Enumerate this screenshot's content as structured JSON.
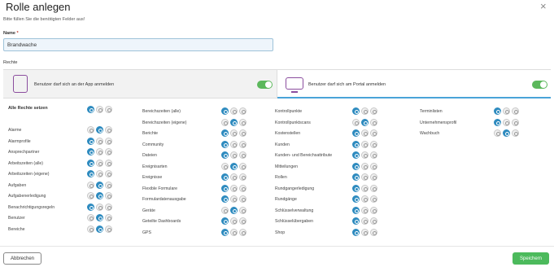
{
  "dialog": {
    "title": "Rolle anlegen",
    "close_glyph": "×",
    "subtitle": "Bitte füllen Sie die benötigten Felder aus!"
  },
  "name_field": {
    "label": "Name",
    "required_mark": "*",
    "value": "Brandwache"
  },
  "rights": {
    "label": "Rechte",
    "app_permission": {
      "text": "Benutzer darf sich an der App anmelden",
      "enabled": true,
      "icon": "phone-icon"
    },
    "portal_permission": {
      "text": "Benutzer darf sich am Portal anmelden",
      "enabled": true,
      "icon": "monitor-icon"
    },
    "all_rights_label": "Alle Rechte setzen",
    "all_rights_state": 0,
    "columns": [
      {
        "items": [
          {
            "label": "Alarme",
            "state": 1
          },
          {
            "label": "Alarmprofile",
            "state": 0
          },
          {
            "label": "Ansprechpartner",
            "state": 0
          },
          {
            "label": "Arbeitszeiten (alle)",
            "state": 0
          },
          {
            "label": "Arbeitszeiten (eigene)",
            "state": 0
          },
          {
            "label": "Aufgaben",
            "state": 1
          },
          {
            "label": "Aufgabenerledigung",
            "state": 1
          },
          {
            "label": "Benachrichtigungsregeln",
            "state": 0
          },
          {
            "label": "Benutzer",
            "state": 1
          },
          {
            "label": "Bereiche",
            "state": 1
          }
        ]
      },
      {
        "items": [
          {
            "label": "Bereichszeiten (alle)",
            "state": 0
          },
          {
            "label": "Bereichszeiten (eigene)",
            "state": 1
          },
          {
            "label": "Berichte",
            "state": 0
          },
          {
            "label": "Community",
            "state": 0
          },
          {
            "label": "Dateien",
            "state": 0
          },
          {
            "label": "Ereignisarten",
            "state": 1
          },
          {
            "label": "Ereignisse",
            "state": 0
          },
          {
            "label": "Flexible Formulare",
            "state": 0
          },
          {
            "label": "Formulardatenausgabe",
            "state": 0
          },
          {
            "label": "Geräte",
            "state": 1
          },
          {
            "label": "Geteilte Dashboards",
            "state": 0
          },
          {
            "label": "GPS",
            "state": 0
          }
        ]
      },
      {
        "items": [
          {
            "label": "Kontrollpunkte",
            "state": 0
          },
          {
            "label": "Kontrollpunktscans",
            "state": 1
          },
          {
            "label": "Kostenstellen",
            "state": 0
          },
          {
            "label": "Kunden",
            "state": 0
          },
          {
            "label": "Kunden- und Bereichsattribute",
            "state": 0
          },
          {
            "label": "Mitteilungen",
            "state": 0
          },
          {
            "label": "Rollen",
            "state": 0
          },
          {
            "label": "Rundgangerledigung",
            "state": 0
          },
          {
            "label": "Rundgänge",
            "state": 0
          },
          {
            "label": "Schlüsselverwaltung",
            "state": 0
          },
          {
            "label": "Schlüsselübergaben",
            "state": 0
          },
          {
            "label": "Shop",
            "state": 0
          }
        ]
      },
      {
        "items": [
          {
            "label": "Terminlisten",
            "state": 0
          },
          {
            "label": "Unternehmensprofil",
            "state": 0
          },
          {
            "label": "Wachbuch",
            "state": 1
          }
        ]
      }
    ]
  },
  "footer": {
    "cancel_label": "Abbrechen",
    "save_label": "Speichern"
  },
  "colors": {
    "accent": "#2e8bbf",
    "toggle_on": "#5cb85c",
    "save_button": "#4cba5c"
  }
}
